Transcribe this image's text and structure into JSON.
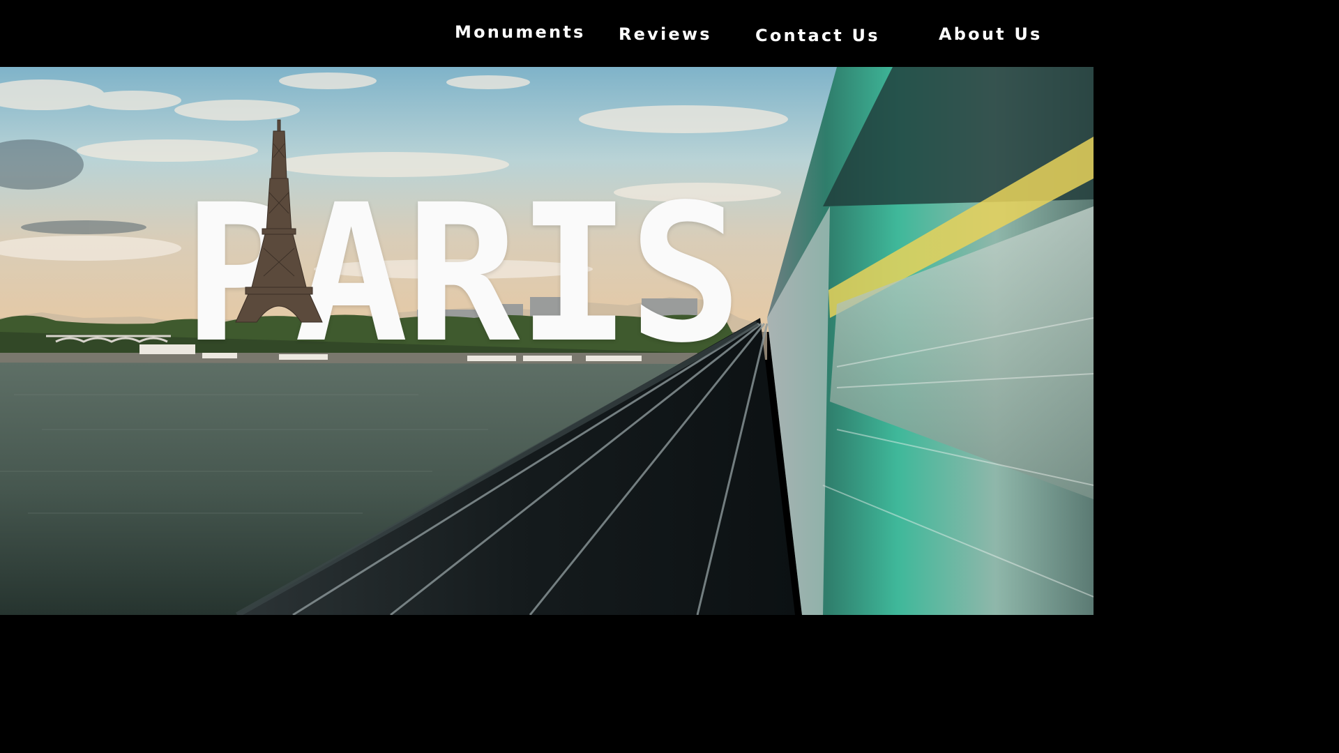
{
  "nav": {
    "items": [
      {
        "label": "Monuments"
      },
      {
        "label": "Reviews"
      },
      {
        "label": "Contact Us"
      },
      {
        "label": "About Us"
      }
    ]
  },
  "hero": {
    "title": "PARIS",
    "scene": "eiffel-tower-seine-river-train-tracks"
  },
  "colors": {
    "nav_background": "#000000",
    "nav_text": "#ffffff",
    "title_text": "#fafafa",
    "train_green": "#3fb89a",
    "train_yellow": "#e8d25a"
  }
}
